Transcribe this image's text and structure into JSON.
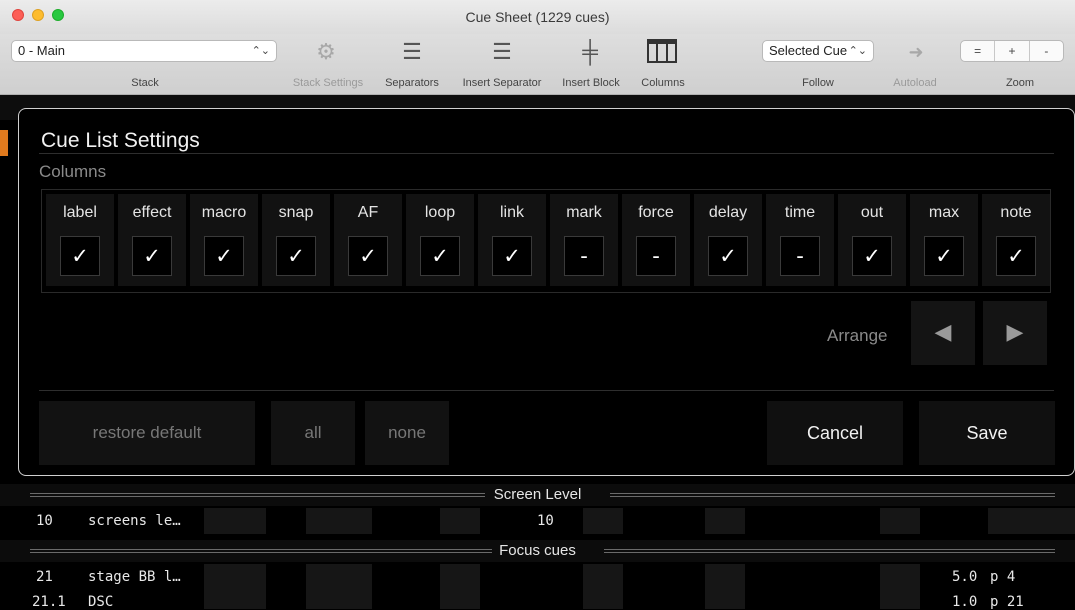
{
  "window": {
    "title": "Cue Sheet (1229 cues)"
  },
  "toolbar": {
    "stack_value": "0 - Main",
    "stack_label": "Stack",
    "stack_settings_label": "Stack Settings",
    "separators_label": "Separators",
    "insert_separator_label": "Insert Separator",
    "insert_block_label": "Insert Block",
    "columns_label": "Columns",
    "follow_value": "Selected Cue",
    "follow_label": "Follow",
    "autoload_label": "Autoload",
    "zoom_label": "Zoom",
    "zoom_buttons": [
      "=",
      "+",
      "-"
    ]
  },
  "dialog": {
    "title": "Cue List Settings",
    "section_label": "Columns",
    "columns": [
      {
        "name": "label",
        "state": "✓"
      },
      {
        "name": "effect",
        "state": "✓"
      },
      {
        "name": "macro",
        "state": "✓"
      },
      {
        "name": "snap",
        "state": "✓"
      },
      {
        "name": "AF",
        "state": "✓"
      },
      {
        "name": "loop",
        "state": "✓"
      },
      {
        "name": "link",
        "state": "✓"
      },
      {
        "name": "mark",
        "state": "-"
      },
      {
        "name": "force",
        "state": "-"
      },
      {
        "name": "delay",
        "state": "✓"
      },
      {
        "name": "time",
        "state": "-"
      },
      {
        "name": "out",
        "state": "✓"
      },
      {
        "name": "max",
        "state": "✓"
      },
      {
        "name": "note",
        "state": "✓"
      }
    ],
    "arrange_label": "Arrange",
    "arrange_left": "◀",
    "arrange_right": "▶",
    "restore_default_label": "restore default",
    "all_label": "all",
    "none_label": "none",
    "cancel_label": "Cancel",
    "save_label": "Save"
  },
  "cue_list": {
    "separator_1": "Screen Level",
    "row_1": {
      "cue": "10",
      "label": "screens le…",
      "level": "10"
    },
    "separator_2": "Focus cues",
    "row_2": {
      "cue": "21",
      "label": "stage BB l…",
      "time": "5.0",
      "note": "p 4"
    },
    "row_3": {
      "cue": "21.1",
      "label": "DSC",
      "time": "1.0",
      "note": "p 21"
    }
  }
}
